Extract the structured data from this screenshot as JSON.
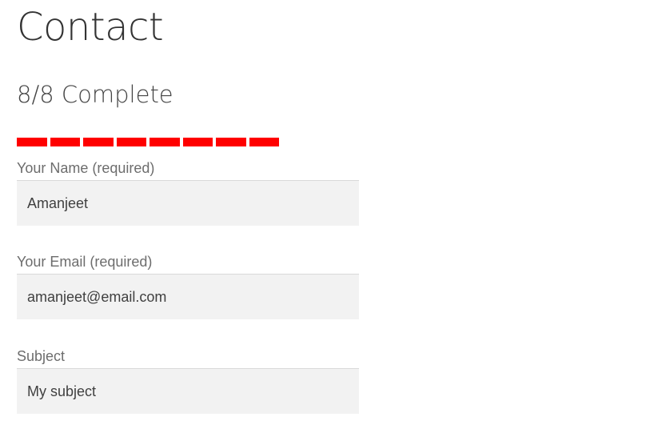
{
  "page": {
    "title": "Contact",
    "progress_text": "8/8 Complete",
    "progress": {
      "completed": 8,
      "total": 8,
      "color": "#ff0000"
    }
  },
  "form": {
    "name": {
      "label": "Your Name (required)",
      "value": "Amanjeet"
    },
    "email": {
      "label": "Your Email (required)",
      "value": "amanjeet@email.com"
    },
    "subject": {
      "label": "Subject",
      "value": "My subject"
    }
  }
}
